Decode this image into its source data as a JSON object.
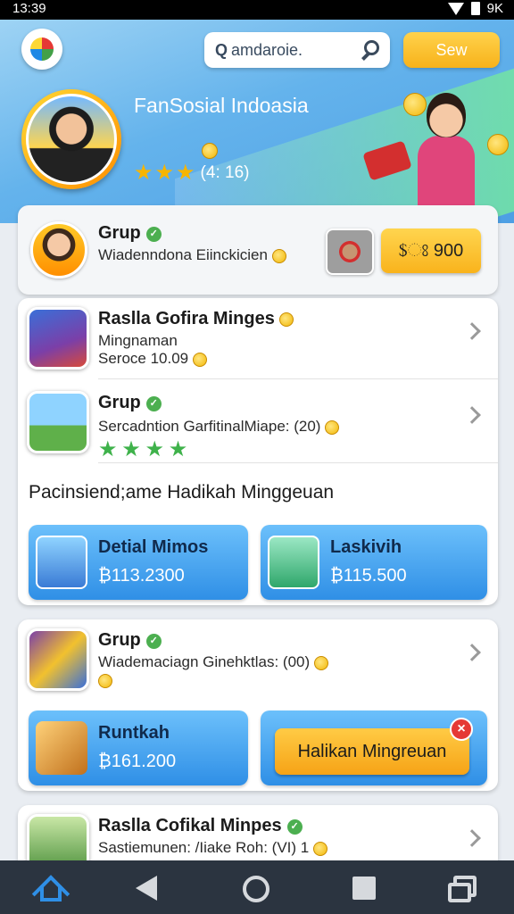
{
  "status_bar": {
    "time": "13:39",
    "battery_text": "9K"
  },
  "header": {
    "search_query_label": "Q",
    "search_text": "amdaroie.",
    "top_button_label": "Sew"
  },
  "profile": {
    "name": "FanSosial Indoasia",
    "stars": [
      "★",
      "★",
      "★"
    ],
    "rating_text": "(4: 16)"
  },
  "group_card": {
    "title": "Grup",
    "subtitle": "Wiadenndona Eiinckicien",
    "price": "$ଃ 900"
  },
  "games": [
    {
      "title": "Raslla Gofira Minges",
      "line1": "Mingnaman",
      "line2": "Seroce 10.09"
    },
    {
      "title": "Grup",
      "line1": "Sercadntion GarfitinalMiape: (20)",
      "green_stars": [
        "★",
        "★",
        "★",
        "★"
      ]
    }
  ],
  "section_heading": "Pacinsiend;ame Hadikah Minggeuan",
  "tiles": [
    {
      "title": "Detial Mimos",
      "price": "₿113.2300"
    },
    {
      "title": "Laskivih",
      "price": "₿115.500"
    }
  ],
  "group_card_2": {
    "title": "Grup",
    "subtitle": "Wiademaciagn Ginehktlas: (00)"
  },
  "tile_3": {
    "title": "Runtkah",
    "price": "₿161.200"
  },
  "cta_button": {
    "label": "Halikan Mingreuan",
    "close_glyph": "×"
  },
  "bottom_game": {
    "title": "Raslla Cofikal Minpes",
    "subtitle": "Sastiemunen: /Iiake Roh: (VI) 1"
  },
  "colors": {
    "accent_blue": "#2f8fe6",
    "accent_yellow": "#f7b21a",
    "verified_green": "#4caf50",
    "nav_bg": "#2b3440"
  },
  "icons": {
    "verified": "✓",
    "chevron": "chevron-right-icon",
    "nav": [
      "home-icon",
      "back-icon",
      "home-circle-icon",
      "stop-square-icon",
      "recents-icon"
    ]
  }
}
